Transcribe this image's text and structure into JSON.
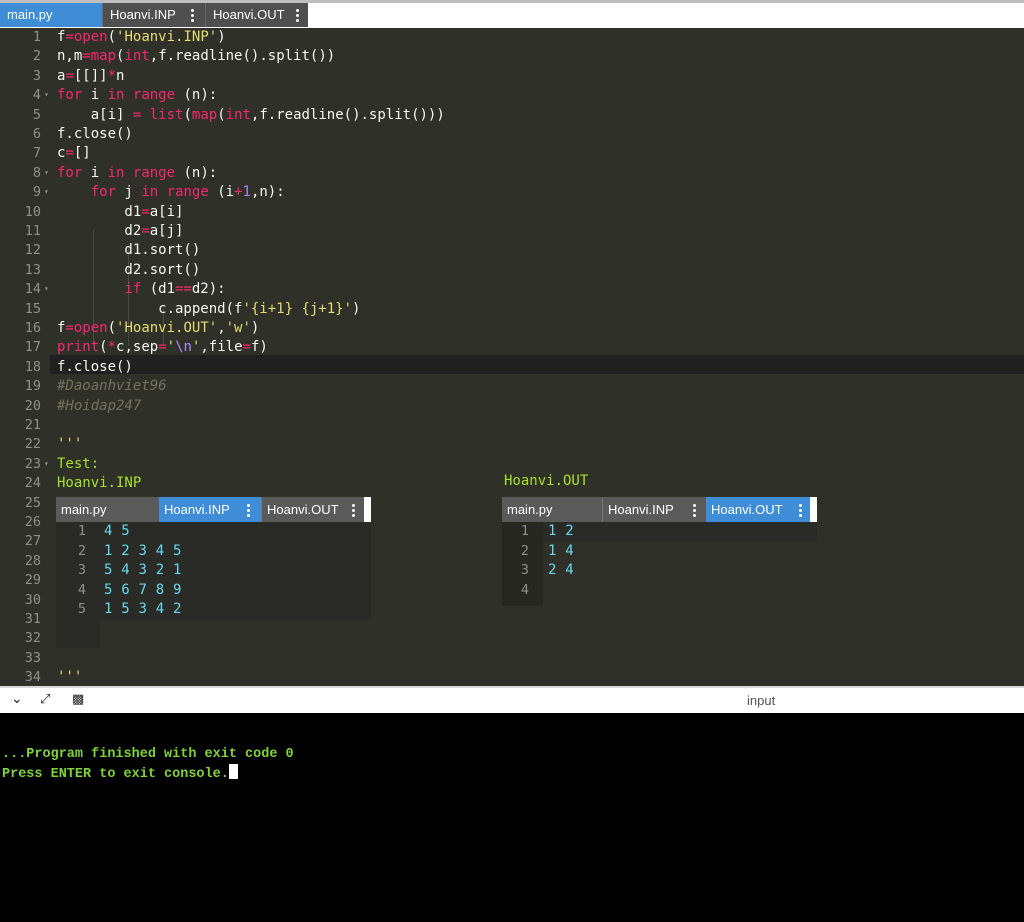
{
  "tabs": [
    {
      "label": "main.py",
      "active": true
    },
    {
      "label": "Hoanvi.INP",
      "active": false
    },
    {
      "label": "Hoanvi.OUT",
      "active": false
    }
  ],
  "editor": {
    "line_numbers": [
      "1",
      "2",
      "3",
      "4",
      "5",
      "6",
      "7",
      "8",
      "9",
      "10",
      "11",
      "12",
      "13",
      "14",
      "15",
      "16",
      "17",
      "18",
      "19",
      "20",
      "21",
      "22",
      "23",
      "24",
      "25",
      "26",
      "27",
      "28",
      "29",
      "30",
      "31",
      "32",
      "33",
      "34"
    ],
    "lines": [
      "f=open('Hoanvi.INP')",
      "n,m=map(int,f.readline().split())",
      "a=[[]]*n",
      "for i in range (n):",
      "    a[i] = list(map(int,f.readline().split()))",
      "f.close()",
      "c=[]",
      "for i in range (n):",
      "    for j in range (i+1,n):",
      "        d1=a[i]",
      "        d2=a[j]",
      "        d1.sort()",
      "        d2.sort()",
      "        if (d1==d2):",
      "            c.append(f'{i+1} {j+1}')",
      "f=open('Hoanvi.OUT','w')",
      "print(*c,sep='\\n',file=f)",
      "f.close()",
      "#Daoanhviet96",
      "#Hoidap247",
      "",
      "'''",
      "Test:",
      "Hoanvi.INP",
      "",
      "",
      "",
      "",
      "",
      "",
      "",
      "",
      "",
      "'''"
    ],
    "out_title": "Hoanvi.OUT"
  },
  "inp_shot": {
    "tabs": [
      {
        "label": "main.py",
        "active": false
      },
      {
        "label": "Hoanvi.INP",
        "active": true
      },
      {
        "label": "Hoanvi.OUT",
        "active": false
      }
    ],
    "line_numbers": [
      "1",
      "2",
      "3",
      "4",
      "5"
    ],
    "rows": [
      "4 5",
      "1 2 3 4 5",
      "5 4 3 2 1",
      "5 6 7 8 9",
      "1 5 3 4 2"
    ]
  },
  "out_shot": {
    "tabs": [
      {
        "label": "main.py",
        "active": false
      },
      {
        "label": "Hoanvi.INP",
        "active": false
      },
      {
        "label": "Hoanvi.OUT",
        "active": true
      }
    ],
    "line_numbers": [
      "1",
      "2",
      "3",
      "4"
    ],
    "rows": [
      "1 2",
      "1 4",
      "2 4",
      ""
    ]
  },
  "console": {
    "header_label": "input",
    "icons": [
      "chevron-down-icon",
      "expand-icon",
      "clear-console-icon"
    ],
    "lines": [
      "...Program finished with exit code 0",
      "Press ENTER to exit console."
    ]
  }
}
